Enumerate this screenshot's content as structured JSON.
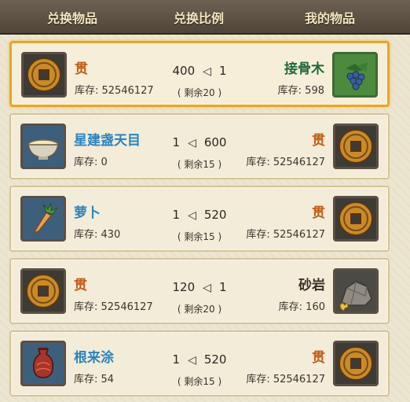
{
  "header": {
    "col1": "兑换物品",
    "col2": "兑换比例",
    "col3": "我的物品"
  },
  "rows": [
    {
      "left_name": "贯",
      "left_stock": "库存: 52546127",
      "ratio_left": "400",
      "ratio_right": "1",
      "remain": "( 剩余20 )",
      "right_name": "接骨木",
      "right_stock": "库存: 598"
    },
    {
      "left_name": "星建盏天目",
      "left_stock": "库存: 0",
      "ratio_left": "1",
      "ratio_right": "600",
      "remain": "( 剩余15 )",
      "right_name": "贯",
      "right_stock": "库存: 52546127"
    },
    {
      "left_name": "萝卜",
      "left_stock": "库存: 430",
      "ratio_left": "1",
      "ratio_right": "520",
      "remain": "( 剩余15 )",
      "right_name": "贯",
      "right_stock": "库存: 52546127"
    },
    {
      "left_name": "贯",
      "left_stock": "库存: 52546127",
      "ratio_left": "120",
      "ratio_right": "1",
      "remain": "( 剩余20 )",
      "right_name": "砂岩",
      "right_stock": "库存: 160"
    },
    {
      "left_name": "根来涂",
      "left_stock": "库存: 54",
      "ratio_left": "1",
      "ratio_right": "520",
      "remain": "( 剩余15 )",
      "right_name": "贯",
      "right_stock": "库存: 52546127"
    }
  ],
  "icons": {
    "coin": "coin-icon",
    "elderberry": "elderberry-icon",
    "tea_bowl": "tea-bowl-icon",
    "carrot": "carrot-icon",
    "sandstone": "sandstone-icon",
    "lacquer_vase": "lacquer-vase-icon",
    "arrow": "◁"
  },
  "colors": {
    "currency": "#c05d16",
    "blue_name": "#2a84be",
    "green_name": "#1f6a3a",
    "selected_border": "#e6a628"
  }
}
